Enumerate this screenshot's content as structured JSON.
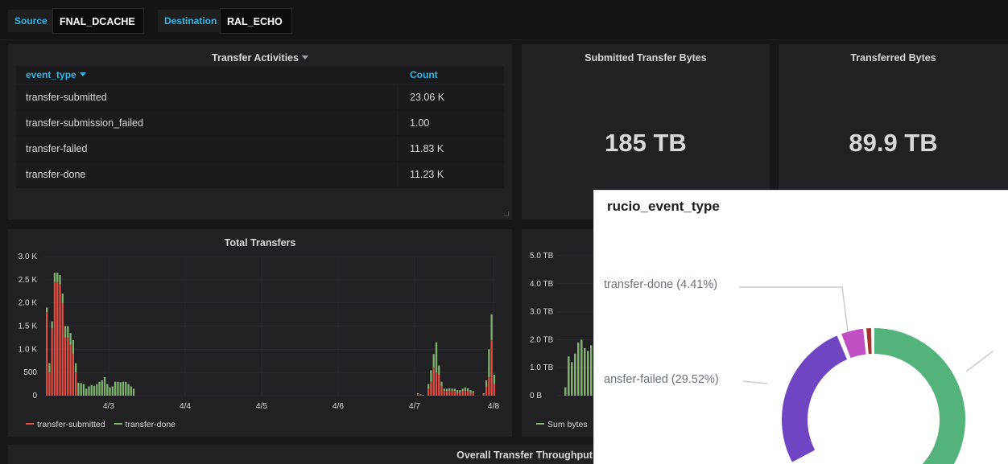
{
  "variables": {
    "source_label": "Source",
    "source_value": "FNAL_DCACHE",
    "destination_label": "Destination",
    "destination_value": "RAL_ECHO"
  },
  "activities": {
    "title": "Transfer Activities",
    "col_event": "event_type",
    "col_count": "Count",
    "rows": [
      {
        "event": "transfer-submitted",
        "count": "23.06 K"
      },
      {
        "event": "transfer-submission_failed",
        "count": "1.00"
      },
      {
        "event": "transfer-failed",
        "count": "11.83 K"
      },
      {
        "event": "transfer-done",
        "count": "11.23 K"
      }
    ]
  },
  "submitted_bytes": {
    "title": "Submitted Transfer Bytes",
    "value": "185 TB"
  },
  "transferred_bytes": {
    "title": "Transferred Bytes",
    "value": "89.9 TB"
  },
  "total_transfers": {
    "title": "Total Transfers",
    "legend": [
      "transfer-submitted",
      "transfer-done"
    ]
  },
  "bytes_panel": {
    "legend": "Sum bytes"
  },
  "throughput": {
    "title": "Overall Transfer Throughput"
  },
  "colors": {
    "submitted": "#e24d42",
    "done": "#7eb26d",
    "accent": "#33b5e5",
    "donut_green": "#54b37a",
    "donut_purple": "#6f45c4",
    "donut_pink": "#c04fc4",
    "donut_red": "#a6322a"
  },
  "overlay": {
    "title": "rucio_event_type",
    "label_done": "transfer-done (4.41%)",
    "label_failed": "ansfer-failed (29.52%)"
  },
  "chart_data": [
    {
      "type": "bar",
      "title": "Total Transfers",
      "x_ticks": [
        "4/3",
        "4/4",
        "4/5",
        "4/6",
        "4/7",
        "4/8"
      ],
      "y_ticks": [
        "0",
        "500",
        "1.0 K",
        "1.5 K",
        "2.0 K",
        "2.5 K",
        "3.0 K"
      ],
      "ylim": [
        0,
        3000
      ],
      "series": [
        {
          "name": "transfer-submitted",
          "values": [
            1800,
            500,
            1450,
            2450,
            2450,
            2400,
            2000,
            1250,
            1250,
            1100,
            900,
            500,
            0,
            0,
            0,
            0,
            0,
            0,
            0,
            0,
            0,
            0,
            0,
            0,
            0,
            0,
            0,
            0,
            0,
            0,
            0,
            0,
            0,
            0,
            0,
            0,
            0,
            0,
            0,
            0,
            0,
            0,
            0,
            0,
            0,
            0,
            0,
            0,
            0,
            0,
            0,
            0,
            0,
            0,
            0,
            0,
            0,
            0,
            0,
            0,
            0,
            0,
            0,
            0,
            0,
            0,
            0,
            0,
            0,
            0,
            0,
            0,
            0,
            0,
            0,
            0,
            0,
            0,
            0,
            0,
            0,
            0,
            0,
            0,
            0,
            0,
            0,
            0,
            0,
            0,
            0,
            0,
            0,
            0,
            0,
            0,
            0,
            0,
            0,
            0,
            0,
            0,
            0,
            0,
            0,
            0,
            0,
            0,
            0,
            0,
            0,
            0,
            0,
            0,
            0,
            0,
            0,
            0,
            0,
            0,
            0,
            0,
            0,
            0,
            0,
            0,
            0,
            0,
            0,
            0,
            0,
            0,
            0,
            0,
            0,
            0,
            0,
            0,
            0,
            0,
            0,
            30,
            20,
            10,
            0,
            150,
            300,
            600,
            500,
            450,
            200,
            100,
            100,
            100,
            100,
            100,
            60,
            70,
            100,
            100,
            100,
            60,
            60,
            0,
            0,
            0,
            30,
            200,
            400,
            1200,
            250
          ]
        },
        {
          "name": "transfer-done",
          "values": [
            100,
            200,
            150,
            200,
            200,
            200,
            200,
            250,
            250,
            250,
            300,
            200,
            280,
            270,
            250,
            150,
            200,
            230,
            210,
            250,
            300,
            330,
            400,
            250,
            180,
            200,
            300,
            300,
            290,
            300,
            300,
            250,
            200,
            150,
            0,
            0,
            0,
            0,
            0,
            0,
            0,
            0,
            0,
            0,
            0,
            0,
            0,
            0,
            0,
            0,
            0,
            0,
            0,
            0,
            0,
            0,
            0,
            0,
            0,
            0,
            0,
            0,
            0,
            0,
            0,
            0,
            0,
            0,
            0,
            0,
            0,
            0,
            0,
            0,
            0,
            0,
            0,
            0,
            0,
            0,
            0,
            0,
            0,
            0,
            0,
            0,
            0,
            0,
            0,
            0,
            0,
            0,
            0,
            0,
            0,
            0,
            0,
            0,
            0,
            0,
            0,
            0,
            0,
            0,
            0,
            0,
            0,
            0,
            0,
            0,
            0,
            0,
            0,
            0,
            0,
            0,
            0,
            0,
            0,
            0,
            0,
            0,
            0,
            0,
            0,
            0,
            0,
            0,
            0,
            0,
            0,
            0,
            0,
            0,
            0,
            0,
            0,
            0,
            0,
            0,
            0,
            20,
            10,
            10,
            0,
            100,
            250,
            300,
            650,
            200,
            100,
            50,
            50,
            60,
            50,
            50,
            60,
            50,
            50,
            80,
            60,
            60,
            40,
            0,
            0,
            0,
            20,
            130,
            600,
            550,
            200
          ]
        }
      ]
    },
    {
      "type": "bar",
      "title": "",
      "y_ticks": [
        "0 B",
        "1.0 TB",
        "2.0 TB",
        "3.0 TB",
        "4.0 TB",
        "5.0 TB"
      ],
      "ylim": [
        0,
        5
      ],
      "series": [
        {
          "name": "Sum bytes",
          "values": [
            0.3,
            1.4,
            1.2,
            1.5,
            1.9,
            2.0,
            1.7,
            1.6,
            1.8
          ]
        }
      ]
    },
    {
      "type": "pie",
      "title": "rucio_event_type",
      "series": [
        {
          "name": "transfer-submitted",
          "values": [
            57.2
          ]
        },
        {
          "name": "transfer-failed",
          "values": [
            29.52
          ]
        },
        {
          "name": "transfer-done",
          "values": [
            4.41
          ]
        },
        {
          "name": "transfer-submission_failed",
          "values": [
            0.01
          ]
        }
      ]
    }
  ]
}
